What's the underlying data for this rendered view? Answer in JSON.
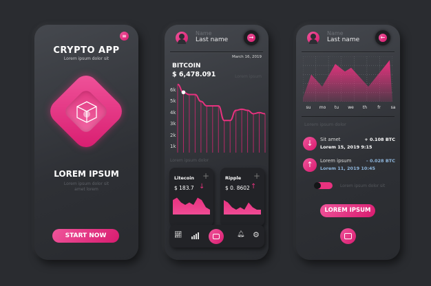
{
  "colors": {
    "accent": "#e8327f",
    "background": "#2a2c30",
    "blue_text": "#8fb7dd"
  },
  "screen1": {
    "title": "CRYPTO APP",
    "subtitle": "Lorem ipsum dolor sit",
    "menu_icon": "hamburger-icon",
    "logo_icon": "cube-icon",
    "heading": "LOREM IPSUM",
    "body_line1": "Lorem ipsum dolor sit",
    "body_line2": "amet lorem",
    "cta": "START NOW"
  },
  "screen2": {
    "name": "Name",
    "last_name": "Last name",
    "date": "March 16, 2019",
    "coin": "BITCOIN",
    "price": "$ 6,478.091",
    "side_text": "Lorem ipsum",
    "y_ticks": [
      "6k",
      "5k",
      "4k",
      "3k",
      "2k",
      "1k"
    ],
    "price_series_k": [
      6.5,
      5.8,
      5.6,
      5.6,
      5.0,
      4.6,
      4.6,
      4.6,
      3.3,
      3.3,
      4.2,
      4.3,
      4.2,
      3.9,
      4.0,
      3.9
    ],
    "section": "Lorem ipsum dolor",
    "cards": [
      {
        "name": "Litecoin",
        "price": "$ 183.7",
        "trend": "down",
        "series": [
          6,
          7,
          5,
          4,
          5,
          4,
          7,
          6,
          3,
          2
        ]
      },
      {
        "name": "Ripple",
        "price": "$ 0. 8602",
        "trend": "up",
        "series": [
          6,
          5,
          3,
          2,
          3,
          2,
          5,
          3,
          2,
          2
        ]
      }
    ],
    "nav": [
      "chart-line-icon",
      "bar-chart-icon",
      "wallet-icon",
      "bell-icon",
      "gear-icon"
    ]
  },
  "screen3": {
    "name": "Name",
    "last_name": "Last name",
    "days": [
      "su",
      "mo",
      "tu",
      "we",
      "th",
      "fr",
      "sa"
    ],
    "weekly_series": [
      0.5,
      3.6,
      2.0,
      5.0,
      4.0,
      4.5,
      2.0,
      5.5
    ],
    "section": "Lorem ipsum dolor",
    "transactions": [
      {
        "direction": "down",
        "label": "Sit amet",
        "amount": "+ 0.108 BTC",
        "date": "Lorem 15, 2019 9:15"
      },
      {
        "direction": "up",
        "label": "Lorem ipsum",
        "amount": "- 0.028 BTC",
        "date": "Lorem 11, 2019 10:45"
      }
    ],
    "toggle_label": "Lorem ipsum dolor sit",
    "toggle_on": true,
    "button": "LOREM IPSUM"
  }
}
